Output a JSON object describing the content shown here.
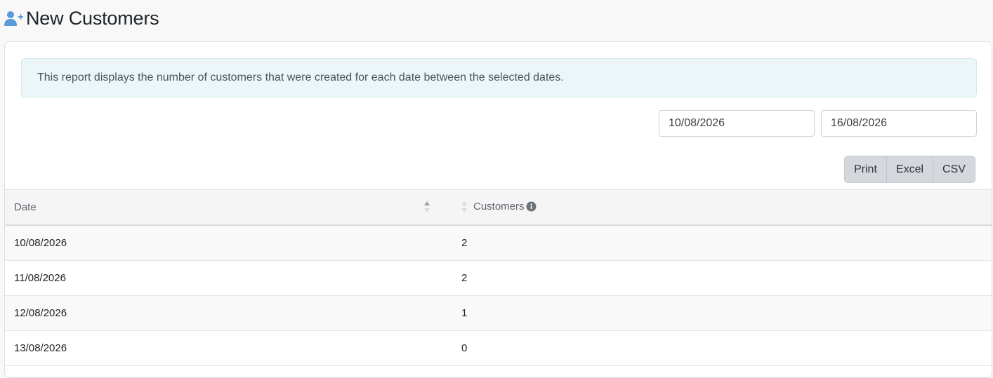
{
  "page": {
    "title": "New Customers",
    "icon": "user-plus-icon",
    "accent_color": "#5b9bd5"
  },
  "alert": {
    "text": "This report displays the number of customers that were created for each date between the selected dates."
  },
  "filters": {
    "date_from": "10/08/2026",
    "date_to": "16/08/2026"
  },
  "export_buttons": {
    "print": "Print",
    "excel": "Excel",
    "csv": "CSV"
  },
  "table": {
    "columns": {
      "date": "Date",
      "customers": "Customers"
    },
    "rows": [
      {
        "date": "10/08/2026",
        "customers": "2"
      },
      {
        "date": "11/08/2026",
        "customers": "2"
      },
      {
        "date": "12/08/2026",
        "customers": "1"
      },
      {
        "date": "13/08/2026",
        "customers": "0"
      }
    ]
  }
}
